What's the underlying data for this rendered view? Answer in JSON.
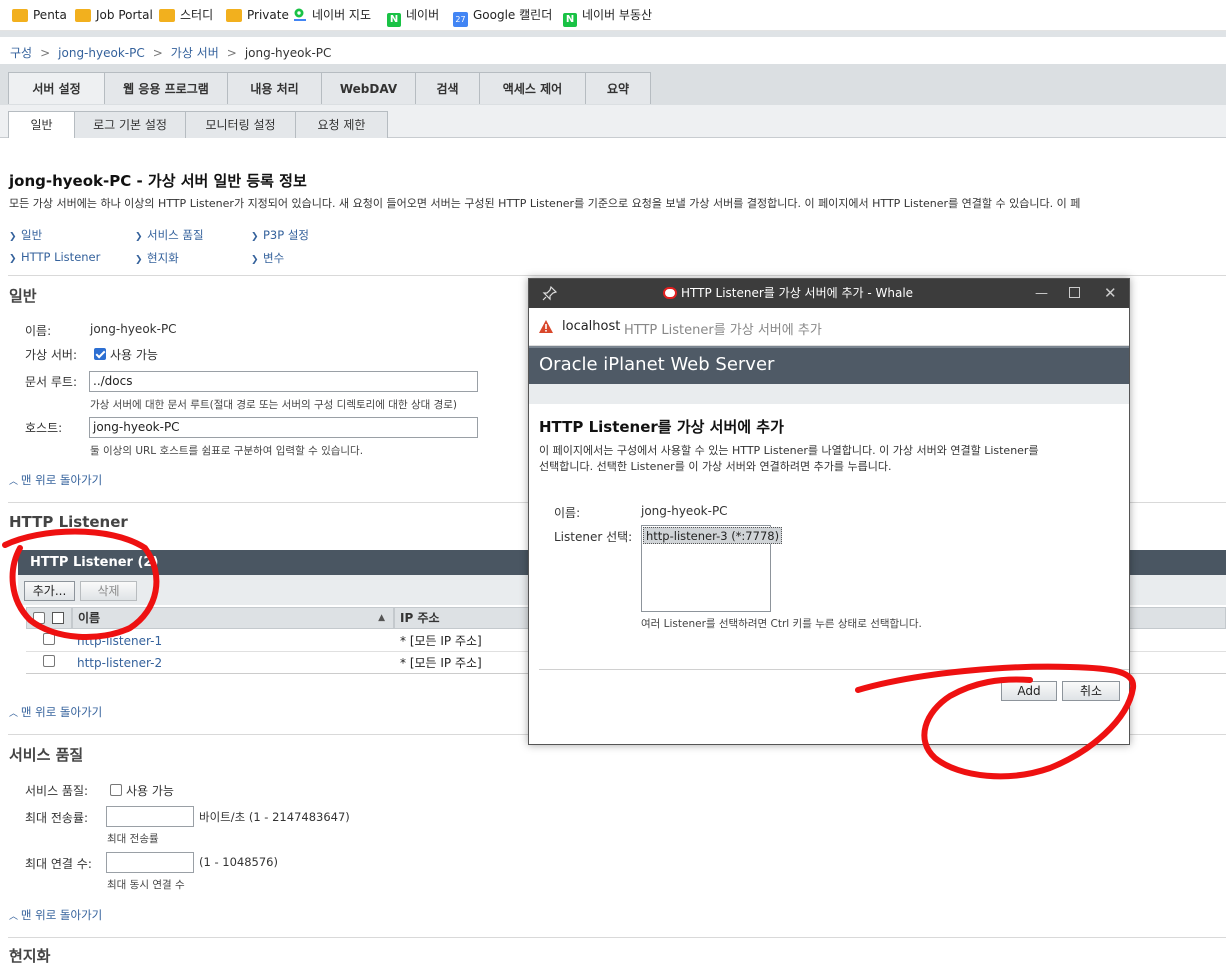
{
  "bookmarks": [
    {
      "label": "Penta",
      "icon": "folder-icon"
    },
    {
      "label": "Job Portal",
      "icon": "folder-icon"
    },
    {
      "label": "스터디",
      "icon": "folder-icon"
    },
    {
      "label": "Private",
      "icon": "folder-icon"
    },
    {
      "label": "네이버 지도",
      "icon": "map-pin-icon"
    },
    {
      "label": "네이버",
      "icon": "naver-icon"
    },
    {
      "label": "Google 캘린더",
      "icon": "calendar-icon",
      "badge": "27"
    },
    {
      "label": "네이버 부동산",
      "icon": "naver-icon"
    }
  ],
  "breadcrumb": {
    "items": [
      "구성",
      "jong-hyeok-PC",
      "가상 서버",
      "jong-hyeok-PC"
    ],
    "separator": ">"
  },
  "tabs_primary": [
    "서버 설정",
    "웹 응용 프로그램",
    "내용 처리",
    "WebDAV",
    "검색",
    "액세스 제어",
    "요약"
  ],
  "tabs_secondary": [
    "일반",
    "로그 기본 설정",
    "모니터링 설정",
    "요청 제한"
  ],
  "page": {
    "title": "jong-hyeok-PC - 가상 서버 일반 등록 정보",
    "description": "모든 가상 서버에는 하나 이상의 HTTP Listener가 지정되어 있습니다. 새 요청이 들어오면 서버는 구성된 HTTP Listener를 기준으로 요청을 보낼 가상 서버를 결정합니다. 이 페이지에서 HTTP Listener를 연결할 수 있습니다. 이 페",
    "jumplinks": [
      "일반",
      "서비스 품질",
      "P3P 설정",
      "HTTP Listener",
      "현지화",
      "변수"
    ],
    "back_to_top": "맨 위로 돌아가기"
  },
  "general": {
    "heading": "일반",
    "name_label": "이름:",
    "name_value": "jong-hyeok-PC",
    "vs_label": "가상 서버:",
    "vs_enabled_label": "사용 가능",
    "vs_enabled": true,
    "docroot_label": "문서 루트:",
    "docroot_value": "../docs",
    "docroot_hint": "가상 서버에 대한 문서 루트(절대 경로 또는 서버의 구성 디렉토리에 대한 상대 경로)",
    "host_label": "호스트:",
    "host_value": "jong-hyeok-PC",
    "host_hint": "둘 이상의 URL 호스트를 쉼표로 구분하여 입력할 수 있습니다."
  },
  "listeners": {
    "heading": "HTTP Listener",
    "table_title": "HTTP Listener (2)",
    "add_button": "추가...",
    "delete_button": "삭제",
    "columns": [
      "이름",
      "IP 주소"
    ],
    "rows": [
      {
        "name": "http-listener-1",
        "ip": "* [모든 IP 주소]"
      },
      {
        "name": "http-listener-2",
        "ip": "* [모든 IP 주소]"
      }
    ]
  },
  "qos": {
    "heading": "서비스 품질",
    "qos_label": "서비스 품질:",
    "qos_enabled_label": "사용 가능",
    "qos_enabled": false,
    "rate_label": "최대 전송률:",
    "rate_unit": "바이트/초 (1 - 2147483647)",
    "rate_hint": "최대 전송률",
    "conn_label": "최대 연결 수:",
    "conn_range": "(1 - 1048576)",
    "conn_hint": "최대 동시 연결 수"
  },
  "next_heading": "현지화",
  "dialog": {
    "window_title": "HTTP Listener를 가상 서버에 추가 - Whale",
    "address_host": "localhost",
    "address_title": "HTTP Listener를 가상 서버에 추가",
    "banner": "Oracle iPlanet Web Server",
    "heading": "HTTP Listener를 가상 서버에 추가",
    "description_1": "이 페이지에서는 구성에서 사용할 수 있는 HTTP Listener를 나열합니다. 이 가상 서버와 연결할 Listener를",
    "description_2": "선택합니다. 선택한 Listener를 이 가상 서버와 연결하려면 추가를 누릅니다.",
    "name_label": "이름:",
    "name_value": "jong-hyeok-PC",
    "select_label": "Listener 선택:",
    "options": [
      "http-listener-3 (*:7778)"
    ],
    "select_hint": "여러 Listener를 선택하려면 Ctrl 키를 누른 상태로 선택합니다.",
    "add_button": "Add",
    "cancel_button": "취소"
  },
  "colors": {
    "link": "#35629c",
    "table_header": "#4a5662",
    "banner": "#4f5a66",
    "annotation": "#ee1111"
  }
}
